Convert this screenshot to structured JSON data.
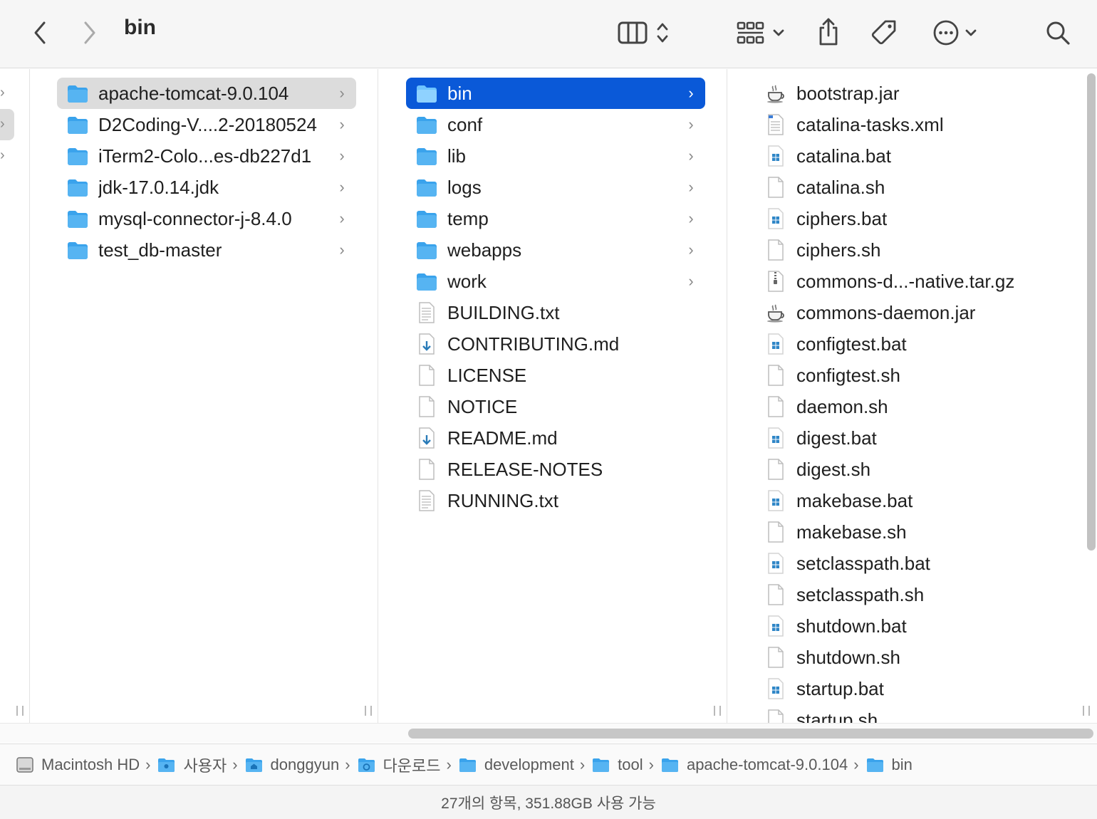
{
  "window": {
    "title": "bin"
  },
  "toolbar": {
    "back_icon": "chevron-left-icon",
    "forward_icon": "chevron-right-icon",
    "view_icon": "column-view-icon",
    "group_icon": "grid-group-icon",
    "share_icon": "share-icon",
    "tag_icon": "tag-icon",
    "more_icon": "ellipsis-circle-icon",
    "search_icon": "search-icon"
  },
  "columns": {
    "col1": {
      "items": [
        {
          "name": "apache-tomcat-9.0.104",
          "kind": "folder",
          "selected": "gray"
        },
        {
          "name": "D2Coding-V....2-20180524",
          "kind": "folder"
        },
        {
          "name": "iTerm2-Colo...es-db227d1",
          "kind": "folder"
        },
        {
          "name": "jdk-17.0.14.jdk",
          "kind": "folder"
        },
        {
          "name": "mysql-connector-j-8.4.0",
          "kind": "folder"
        },
        {
          "name": "test_db-master",
          "kind": "folder"
        }
      ]
    },
    "col2": {
      "items": [
        {
          "name": "bin",
          "kind": "folder",
          "selected": "blue"
        },
        {
          "name": "conf",
          "kind": "folder"
        },
        {
          "name": "lib",
          "kind": "folder"
        },
        {
          "name": "logs",
          "kind": "folder"
        },
        {
          "name": "temp",
          "kind": "folder"
        },
        {
          "name": "webapps",
          "kind": "folder"
        },
        {
          "name": "work",
          "kind": "folder"
        },
        {
          "name": "BUILDING.txt",
          "kind": "text"
        },
        {
          "name": "CONTRIBUTING.md",
          "kind": "md"
        },
        {
          "name": "LICENSE",
          "kind": "doc"
        },
        {
          "name": "NOTICE",
          "kind": "doc"
        },
        {
          "name": "README.md",
          "kind": "md"
        },
        {
          "name": "RELEASE-NOTES",
          "kind": "doc"
        },
        {
          "name": "RUNNING.txt",
          "kind": "text"
        }
      ]
    },
    "col3": {
      "items": [
        {
          "name": "bootstrap.jar",
          "kind": "jar"
        },
        {
          "name": "catalina-tasks.xml",
          "kind": "xml"
        },
        {
          "name": "catalina.bat",
          "kind": "bat"
        },
        {
          "name": "catalina.sh",
          "kind": "doc"
        },
        {
          "name": "ciphers.bat",
          "kind": "bat"
        },
        {
          "name": "ciphers.sh",
          "kind": "doc"
        },
        {
          "name": "commons-d...-native.tar.gz",
          "kind": "archive"
        },
        {
          "name": "commons-daemon.jar",
          "kind": "jar"
        },
        {
          "name": "configtest.bat",
          "kind": "bat"
        },
        {
          "name": "configtest.sh",
          "kind": "doc"
        },
        {
          "name": "daemon.sh",
          "kind": "doc"
        },
        {
          "name": "digest.bat",
          "kind": "bat"
        },
        {
          "name": "digest.sh",
          "kind": "doc"
        },
        {
          "name": "makebase.bat",
          "kind": "bat"
        },
        {
          "name": "makebase.sh",
          "kind": "doc"
        },
        {
          "name": "setclasspath.bat",
          "kind": "bat"
        },
        {
          "name": "setclasspath.sh",
          "kind": "doc"
        },
        {
          "name": "shutdown.bat",
          "kind": "bat"
        },
        {
          "name": "shutdown.sh",
          "kind": "doc"
        },
        {
          "name": "startup.bat",
          "kind": "bat"
        },
        {
          "name": "startup.sh",
          "kind": "doc"
        }
      ]
    }
  },
  "pathbar": [
    {
      "label": "Macintosh HD",
      "icon": "hard-drive-icon"
    },
    {
      "label": "사용자",
      "icon": "users-folder-icon"
    },
    {
      "label": "donggyun",
      "icon": "home-folder-icon"
    },
    {
      "label": "다운로드",
      "icon": "downloads-folder-icon"
    },
    {
      "label": "development",
      "icon": "folder-icon"
    },
    {
      "label": "tool",
      "icon": "folder-icon"
    },
    {
      "label": "apache-tomcat-9.0.104",
      "icon": "folder-icon"
    },
    {
      "label": "bin",
      "icon": "folder-icon"
    }
  ],
  "status": {
    "text": "27개의 항목, 351.88GB 사용 가능"
  },
  "colors": {
    "selection_blue": "#0a59d8",
    "folder_blue": "#3aa3ec",
    "selection_gray": "#dcdcdc"
  }
}
